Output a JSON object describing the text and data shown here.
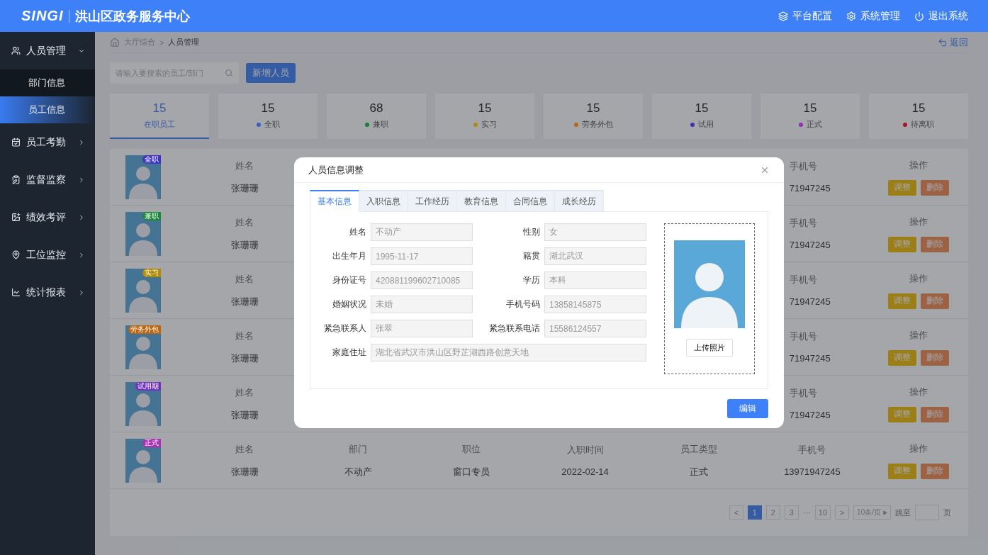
{
  "header": {
    "logo": "SINGI",
    "title": "洪山区政务服务中心",
    "actions": [
      {
        "label": "平台配置"
      },
      {
        "label": "系统管理"
      },
      {
        "label": "退出系统"
      }
    ]
  },
  "sidebar": {
    "items": [
      {
        "label": "人员管理",
        "expanded": true,
        "children": [
          {
            "label": "部门信息",
            "selected": false
          },
          {
            "label": "员工信息",
            "selected": true
          }
        ]
      },
      {
        "label": "员工考勤",
        "expanded": false
      },
      {
        "label": "监督监察",
        "expanded": false
      },
      {
        "label": "绩效考评",
        "expanded": false
      },
      {
        "label": "工位监控",
        "expanded": false
      },
      {
        "label": "统计报表",
        "expanded": false
      }
    ]
  },
  "breadcrumb": {
    "items": [
      "大厅综合",
      "人员管理"
    ],
    "separator": ">",
    "back": "返回"
  },
  "search": {
    "placeholder": "请输入要搜索的员工/部门"
  },
  "add_button": "新增人员",
  "stats": [
    {
      "count": "15",
      "label": "在职员工",
      "selected": true
    },
    {
      "count": "15",
      "label": "全职",
      "color": "#3a5fc0",
      "selected": false
    },
    {
      "count": "68",
      "label": "兼职",
      "color": "#1b7a3e",
      "selected": false
    },
    {
      "count": "15",
      "label": "实习",
      "color": "#b08a10",
      "selected": false
    },
    {
      "count": "15",
      "label": "劳务外包",
      "color": "#b8661a",
      "selected": false
    },
    {
      "count": "15",
      "label": "试用",
      "color": "#4a2cb0",
      "selected": false
    },
    {
      "count": "15",
      "label": "正式",
      "color": "#9030b0",
      "selected": false
    },
    {
      "count": "15",
      "label": "待离职",
      "color": "#a8102a",
      "selected": false
    }
  ],
  "employees": [
    {
      "badge": "全职",
      "color": "#3e32c8",
      "cells": [
        {
          "label": "姓名",
          "value": "张珊珊"
        },
        {
          "label": "手机号",
          "value": "71947245"
        }
      ],
      "actions_label": "操作",
      "actions": [
        {
          "label": "调整",
          "kind": "adjust"
        },
        {
          "label": "删除",
          "kind": "delete"
        }
      ]
    },
    {
      "badge": "兼职",
      "color": "#1a8a3a",
      "cells": [
        {
          "label": "姓名",
          "value": "张珊珊"
        },
        {
          "label": "手机号",
          "value": "71947245"
        }
      ],
      "actions_label": "操作",
      "actions": [
        {
          "label": "调整",
          "kind": "adjust"
        },
        {
          "label": "删除",
          "kind": "delete"
        }
      ]
    },
    {
      "badge": "实习",
      "color": "#b08a08",
      "cells": [
        {
          "label": "姓名",
          "value": "张珊珊"
        },
        {
          "label": "手机号",
          "value": "71947245"
        }
      ],
      "actions_label": "操作",
      "actions": [
        {
          "label": "调整",
          "kind": "adjust"
        },
        {
          "label": "删除",
          "kind": "delete"
        }
      ]
    },
    {
      "badge": "劳务外包",
      "color": "#c0640e",
      "cells": [
        {
          "label": "姓名",
          "value": "张珊珊"
        },
        {
          "label": "手机号",
          "value": "71947245"
        }
      ],
      "actions_label": "操作",
      "actions": [
        {
          "label": "调整",
          "kind": "adjust"
        },
        {
          "label": "删除",
          "kind": "delete"
        }
      ]
    },
    {
      "badge": "试用期",
      "color": "#7232c0",
      "cells": [
        {
          "label": "姓名",
          "value": "张珊珊"
        },
        {
          "label": "手机号",
          "value": "71947245"
        }
      ],
      "actions_label": "操作",
      "actions": [
        {
          "label": "调整",
          "kind": "adjust"
        },
        {
          "label": "删除",
          "kind": "delete"
        }
      ]
    },
    {
      "badge": "正式",
      "color": "#a832b0",
      "actions_label": "操作",
      "cells": [
        {
          "label": "姓名",
          "value": "张珊珊"
        },
        {
          "label": "部门",
          "value": "不动产"
        },
        {
          "label": "职位",
          "value": "窗口专员"
        },
        {
          "label": "入职时间",
          "value": "2022-02-14"
        },
        {
          "label": "员工类型",
          "value": "正式"
        },
        {
          "label": "手机号",
          "value": "13971947245"
        }
      ],
      "actions": [
        {
          "label": "调整",
          "kind": "adjust"
        },
        {
          "label": "删除",
          "kind": "delete"
        }
      ]
    }
  ],
  "pagination": {
    "prev": "<",
    "pages": [
      {
        "label": "1",
        "selected": true
      },
      {
        "label": "2",
        "selected": false
      },
      {
        "label": "3",
        "selected": false
      }
    ],
    "ellipsis": "···",
    "last": "10",
    "next": ">",
    "page_size": "10条/页",
    "jump_label": "跳至",
    "page_unit": "页"
  },
  "modal": {
    "title": "人员信息调整",
    "tabs": [
      {
        "label": "基本信息",
        "selected": true
      },
      {
        "label": "入职信息",
        "selected": false
      },
      {
        "label": "工作经历",
        "selected": false
      },
      {
        "label": "教育信息",
        "selected": false
      },
      {
        "label": "合同信息",
        "selected": false
      },
      {
        "label": "成长经历",
        "selected": false
      }
    ],
    "readonly": true,
    "fields": [
      {
        "label": "姓名",
        "value": "不动产",
        "kind": "half"
      },
      {
        "label": "性别",
        "value": "女",
        "kind": "half"
      },
      {
        "label": "出生年月",
        "value": "1995-11-17",
        "kind": "half"
      },
      {
        "label": "籍贯",
        "value": "湖北武汉",
        "kind": "half"
      },
      {
        "label": "身份证号",
        "value": "420881199602710085",
        "kind": "half"
      },
      {
        "label": "学历",
        "value": "本科",
        "kind": "half"
      },
      {
        "label": "婚姻状况",
        "value": "未婚",
        "kind": "half"
      },
      {
        "label": "手机号码",
        "value": "13858145875",
        "kind": "half"
      },
      {
        "label": "紧急联系人",
        "value": "张翠",
        "kind": "half"
      },
      {
        "label": "紧急联系电话",
        "value": "15586124557",
        "kind": "half"
      },
      {
        "label": "家庭住址",
        "value": "湖北省武汉市洪山区野芷湖西路创意天地",
        "kind": "wide"
      }
    ],
    "upload_button": "上传照片",
    "edit_button": "编辑"
  }
}
